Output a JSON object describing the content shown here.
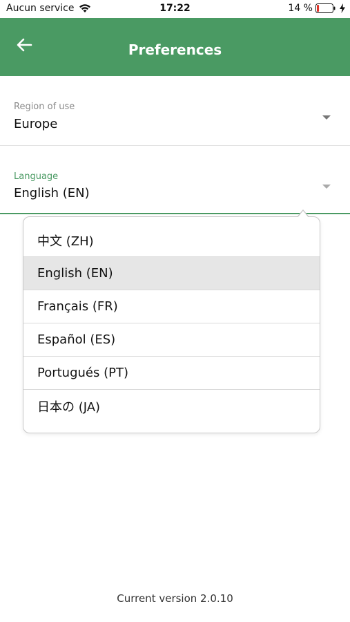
{
  "status_bar": {
    "carrier": "Aucun service",
    "time": "17:22",
    "battery_percent": "14 %",
    "battery_level": 0.14,
    "icons": [
      "wifi-icon",
      "battery-icon",
      "charging-bolt-icon"
    ]
  },
  "app_bar": {
    "title": "Preferences",
    "back_icon": "arrow-left-icon",
    "color": "#4a9a63"
  },
  "fields": {
    "region": {
      "label": "Region of use",
      "value": "Europe"
    },
    "language": {
      "label": "Language",
      "value": "English (EN)"
    }
  },
  "language_dropdown": {
    "selected_index": 1,
    "options": [
      "中文 (ZH)",
      "English (EN)",
      "Français (FR)",
      "Español (ES)",
      "Portugués (PT)",
      "日本の (JA)"
    ]
  },
  "footer": {
    "version": "Current version 2.0.10"
  },
  "colors": {
    "accent": "#4a9a63",
    "selected_row": "#e6e6e6"
  }
}
